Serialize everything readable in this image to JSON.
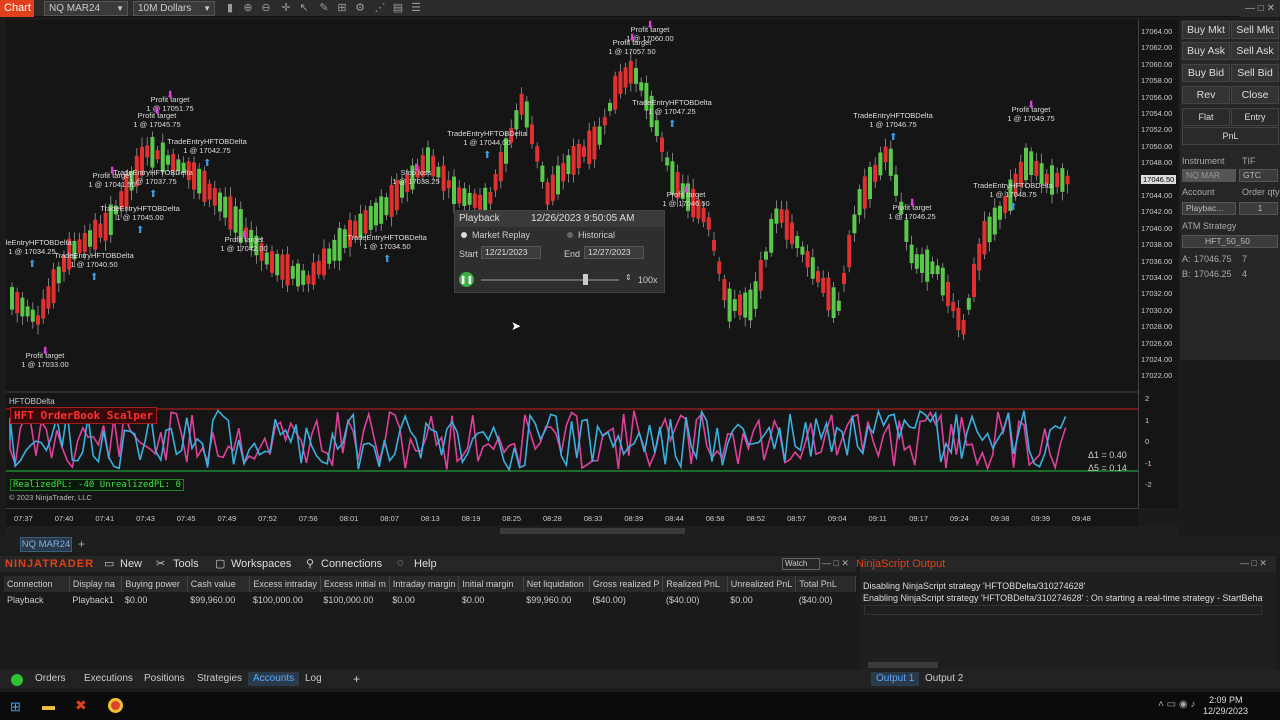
{
  "toolbar": {
    "chart_tab": "Chart",
    "instrument": "NQ MAR24",
    "bar_type": "10M Dollars",
    "icons": [
      "bar-type-icon",
      "zoom-icon",
      "zoom-out-icon",
      "crosshair-icon",
      "draw-icon",
      "indicators-icon",
      "strategies-icon",
      "templates-icon",
      "properties-icon"
    ]
  },
  "chart": {
    "price_labels": [
      "17064.00",
      "17062.00",
      "17060.00",
      "17058.00",
      "17056.00",
      "17054.00",
      "17052.00",
      "17050.00",
      "17048.00",
      "17046.50",
      "17044.00",
      "17042.00",
      "17040.00",
      "17038.00",
      "17036.00",
      "17034.00",
      "17032.00",
      "17030.00",
      "17028.00",
      "17026.00",
      "17024.00",
      "17022.00"
    ],
    "current_price": "17046.50",
    "time_labels": [
      "07:37",
      "07:40",
      "07:41",
      "07:43",
      "07:45",
      "07:49",
      "07:52",
      "07:56",
      "08:01",
      "08:07",
      "08:13",
      "08:19",
      "08:25",
      "08:28",
      "08:33",
      "08:39",
      "08:44",
      "08:58",
      "08:52",
      "08:57",
      "09:04",
      "09:11",
      "09:17",
      "09:24",
      "09:38",
      "09:39",
      "09:48"
    ],
    "annotations": [
      {
        "t1": "TradeEntryHFTOBDelta",
        "t2": "1 @ 17034.25"
      },
      {
        "t1": "Profit target",
        "t2": "1 @ 17033.00"
      },
      {
        "t1": "Profit target",
        "t2": "1 @ 17041.50"
      },
      {
        "t1": "TradeEntryHFTOBDelta",
        "t2": "1 @ 17040.50"
      },
      {
        "t1": "Profit target",
        "t2": "1 @ 17051.75"
      },
      {
        "t1": "Profit target",
        "t2": "1 @ 17045.75"
      },
      {
        "t1": "TradeEntryHFTOBDelta",
        "t2": "1 @ 17042.75"
      },
      {
        "t1": "TradeEntryHFTOBDelta",
        "t2": "1 @ 17037.75"
      },
      {
        "t1": "TradeEntryHFTOBDelta",
        "t2": "1 @ 17045.00"
      },
      {
        "t1": "Profit target",
        "t2": "1 @ 17042.00"
      },
      {
        "t1": "Stop loss",
        "t2": "1 @ 17038.25"
      },
      {
        "t1": "TradeEntryHFTOBDelta",
        "t2": "1 @ 17034.50"
      },
      {
        "t1": "TradeEntryHFTOBDelta",
        "t2": "1 @ 17044.00"
      },
      {
        "t1": "Profit target",
        "t2": "1 @ 17060.00"
      },
      {
        "t1": "Profit target",
        "t2": "1 @ 17057.50"
      },
      {
        "t1": "TradeEntryHFTOBDelta",
        "t2": "1 @ 17047.25"
      },
      {
        "t1": "Profit target",
        "t2": "1 @ 17046.50"
      },
      {
        "t1": "TradeEntryHFTOBDelta",
        "t2": "1 @ 17046.75"
      },
      {
        "t1": "Profit target",
        "t2": "1 @ 17046.25"
      },
      {
        "t1": "Profit target",
        "t2": "1 @ 17049.75"
      },
      {
        "t1": "TradeEntryHFTOBDelta",
        "t2": "1 @ 17048.75"
      }
    ]
  },
  "indicator": {
    "name": "HFTOBDelta",
    "banner": "HFT OrderBook Scalper",
    "pl_text": "RealizedPL: -40  UnrealizedPL: 0",
    "copyright": "© 2023 NinjaTrader, LLC",
    "delta1": "Δ1 = 0.40",
    "delta5": "Δ5 = 0.14",
    "axis": [
      "2",
      "1",
      "0",
      "-1",
      "-2"
    ],
    "colors": {
      "line1": "#e0409a",
      "line2": "#3ab0e0",
      "upper": "#d02020",
      "lower": "#20c040"
    }
  },
  "playback": {
    "title": "Playback",
    "datetime": "12/26/2023 9:50:05 AM",
    "mode_market_replay": "Market Replay",
    "mode_historical": "Historical",
    "start_label": "Start",
    "start_value": "12/21/2023",
    "end_label": "End",
    "end_value": "12/27/2023",
    "speed": "100x",
    "position": 0.75
  },
  "right_panel": {
    "buy_mkt": "Buy Mkt",
    "sell_mkt": "Sell Mkt",
    "buy_ask": "Buy Ask",
    "sell_ask": "Sell Ask",
    "buy_bid": "Buy Bid",
    "sell_bid": "Sell Bid",
    "rev": "Rev",
    "close": "Close",
    "flat": "Flat",
    "entry": "Entry",
    "pnl": "PnL",
    "instrument_label": "Instrument",
    "tif_label": "TIF",
    "instrument_value": "NQ MAR",
    "tif_value": "GTC",
    "account_label": "Account",
    "order_qty_label": "Order qty",
    "account_value": "Playbac...",
    "order_qty_value": "1",
    "atm_label": "ATM Strategy",
    "atm_value": "HFT_50_50",
    "ask_label": "A:",
    "ask_price": "17046.75",
    "ask_size": "7",
    "bid_label": "B:",
    "bid_price": "17046.25",
    "bid_size": "4"
  },
  "chart_tabs": {
    "active": "NQ MAR24",
    "add": "+"
  },
  "menu": {
    "brand": "NINJATRADER",
    "new": "New",
    "tools": "Tools",
    "workspaces": "Workspaces",
    "connections": "Connections",
    "help": "Help",
    "watch": "Watch",
    "output_title": "NinjaScript Output"
  },
  "accounts": {
    "headers": [
      "Connection",
      "Display na",
      "Buying power",
      "Cash value",
      "Excess intraday",
      "Excess initial m",
      "Intraday margin",
      "Initial margin",
      "Net liquidation",
      "Gross realized P",
      "Realized PnL",
      "Unrealized PnL",
      "Total PnL"
    ],
    "row": [
      "Playback",
      "Playback1",
      "$0.00",
      "$99,960.00",
      "$100,000.00",
      "$100,000.00",
      "$0.00",
      "$0.00",
      "$99,960.00",
      "($40.00)",
      "($40.00)",
      "$0.00",
      "($40.00)"
    ]
  },
  "output": {
    "line1": "Disabling NinjaScript strategy 'HFTOBDelta/310274628'",
    "line2": "Enabling NinjaScript strategy 'HFTOBDelta/310274628' : On starting a real-time strategy - StartBehavior=WaitU",
    "tab1": "Output 1",
    "tab2": "Output 2"
  },
  "bottom_tabs": [
    "Orders",
    "Executions",
    "Positions",
    "Strategies",
    "Accounts",
    "Log"
  ],
  "bottom_tabs_active": "Accounts",
  "taskbar": {
    "time": "2:09 PM",
    "date": "12/29/2023"
  }
}
